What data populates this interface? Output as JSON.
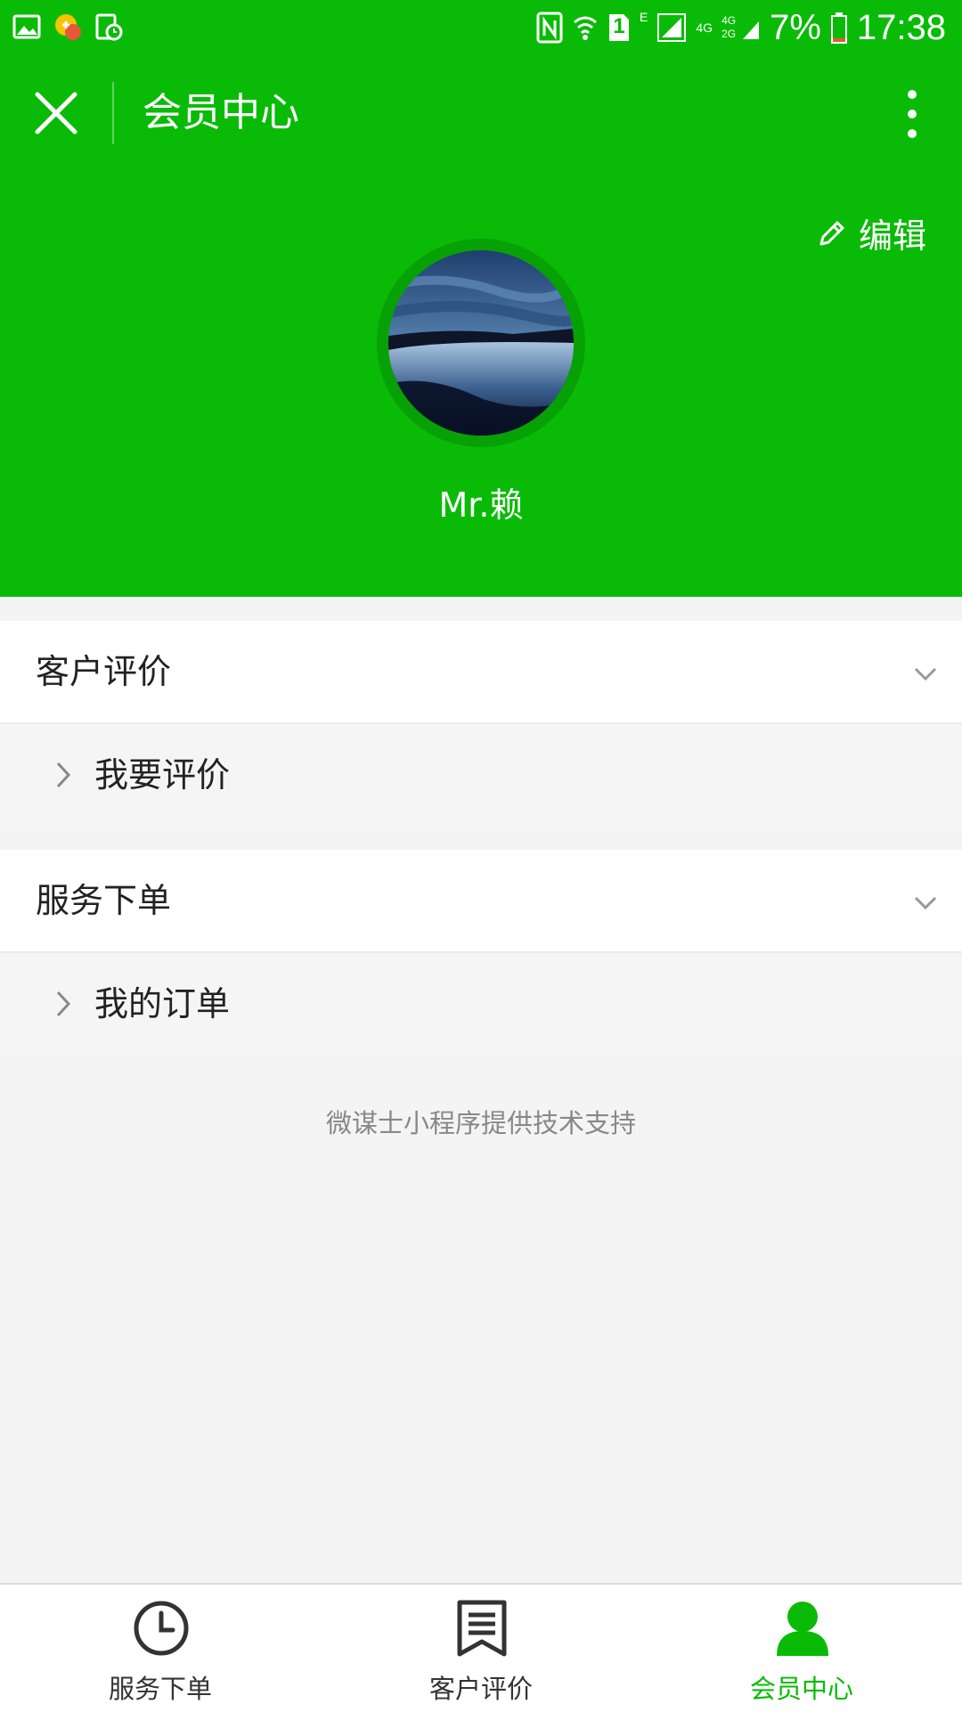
{
  "status_bar": {
    "battery": "7%",
    "time": "17:38",
    "network_e": "E",
    "network_4g": "4G",
    "network_4g_2g": "4G 2G",
    "sim_slot": "1"
  },
  "navbar": {
    "title": "会员中心",
    "close_icon": "close-icon",
    "more_icon": "more-vertical-icon"
  },
  "profile": {
    "edit_label": "编辑",
    "username": "Mr.赖"
  },
  "sections": [
    {
      "title": "客户评价",
      "items": [
        {
          "label": "我要评价"
        }
      ]
    },
    {
      "title": "服务下单",
      "items": [
        {
          "label": "我的订单"
        }
      ]
    }
  ],
  "footer_note": "微谋士小程序提供技术支持",
  "tabbar": {
    "tabs": [
      {
        "label": "服务下单",
        "icon": "clock-icon",
        "active": false
      },
      {
        "label": "客户评价",
        "icon": "bookmark-list-icon",
        "active": false
      },
      {
        "label": "会员中心",
        "icon": "user-icon",
        "active": true
      }
    ]
  },
  "colors": {
    "brand_green": "#09bb07",
    "page_background": "#f4f4f4",
    "active_tab": "#09bb07"
  }
}
